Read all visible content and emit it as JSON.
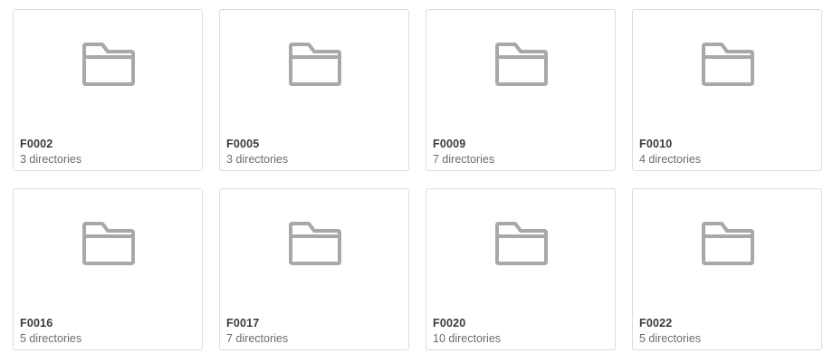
{
  "folders": [
    {
      "name": "F0002",
      "count": "3 directories",
      "icon": "folder-icon"
    },
    {
      "name": "F0005",
      "count": "3 directories",
      "icon": "folder-icon"
    },
    {
      "name": "F0009",
      "count": "7 directories",
      "icon": "folder-icon"
    },
    {
      "name": "F0010",
      "count": "4 directories",
      "icon": "folder-icon"
    },
    {
      "name": "F0016",
      "count": "5 directories",
      "icon": "folder-icon"
    },
    {
      "name": "F0017",
      "count": "7 directories",
      "icon": "folder-icon"
    },
    {
      "name": "F0020",
      "count": "10 directories",
      "icon": "folder-icon"
    },
    {
      "name": "F0022",
      "count": "5 directories",
      "icon": "folder-icon"
    }
  ],
  "colors": {
    "icon": "#a8a8a8",
    "border": "#dcdcdc",
    "name_text": "#3a3a3a",
    "count_text": "#6b6b6b"
  }
}
